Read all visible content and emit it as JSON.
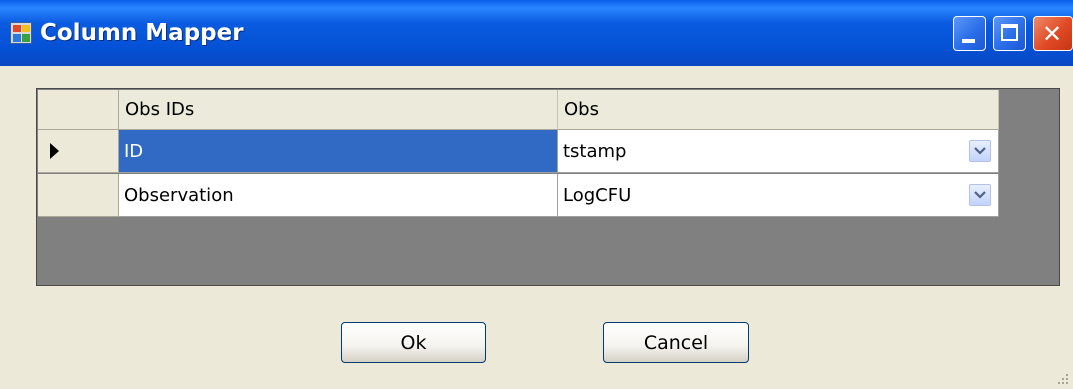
{
  "window": {
    "title": "Column Mapper"
  },
  "grid": {
    "columns": [
      "Obs IDs",
      "Obs"
    ],
    "rows": [
      {
        "obs_id": "ID",
        "obs": "tstamp",
        "current": true
      },
      {
        "obs_id": "Observation",
        "obs": "LogCFU",
        "current": false
      }
    ],
    "selection_color": "#316ac5"
  },
  "buttons": {
    "ok": "Ok",
    "cancel": "Cancel"
  },
  "icons": {
    "app": "app-icon",
    "minimize": "minimize-icon",
    "maximize": "maximize-icon",
    "close": "close-icon",
    "row_pointer": "current-row-arrow-icon",
    "dropdown": "chevron-down-icon"
  }
}
